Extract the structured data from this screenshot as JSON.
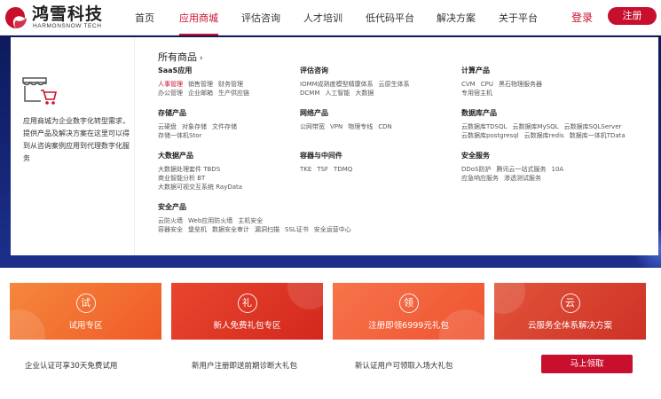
{
  "brand": {
    "name_cn": "鸿雪科技",
    "name_en": "HARMONSNOW TECH"
  },
  "nav": {
    "items": [
      {
        "label": "首页",
        "active": false
      },
      {
        "label": "应用商城",
        "active": true
      },
      {
        "label": "评估咨询",
        "active": false
      },
      {
        "label": "人才培训",
        "active": false
      },
      {
        "label": "低代码平台",
        "active": false
      },
      {
        "label": "解决方案",
        "active": false
      },
      {
        "label": "关于平台",
        "active": false
      }
    ],
    "login": "登录",
    "register": "注册"
  },
  "dropdown": {
    "description": "应用商城为企业数字化转型需求，提供产品及解决方案在这里可以得到从咨询案例应用到代理数字化服务",
    "all_products": "所有商品",
    "categories": [
      {
        "title": "SaaS应用",
        "lines": [
          [
            {
              "t": "人事管理",
              "hl": true
            },
            {
              "t": "销售管理"
            },
            {
              "t": "财务管理"
            }
          ],
          [
            {
              "t": "办公管理"
            },
            {
              "t": "企业邮箱"
            },
            {
              "t": "生产供应链"
            }
          ]
        ]
      },
      {
        "title": "评估咨询",
        "lines": [
          [
            {
              "t": "IOMM成熟度模型精康体系"
            },
            {
              "t": "云原生体系"
            }
          ],
          [
            {
              "t": "DCMM"
            },
            {
              "t": "人工智能"
            },
            {
              "t": "大数据"
            }
          ]
        ]
      },
      {
        "title": "计算产品",
        "lines": [
          [
            {
              "t": "CVM"
            },
            {
              "t": "CPU"
            },
            {
              "t": "黑石物理服务器"
            }
          ],
          [
            {
              "t": "专用宿主机"
            }
          ]
        ]
      },
      {
        "title": "存储产品",
        "lines": [
          [
            {
              "t": "云硬盘"
            },
            {
              "t": "对象存储"
            },
            {
              "t": "文件存储"
            }
          ],
          [
            {
              "t": "存储一体机Stor"
            }
          ]
        ]
      },
      {
        "title": "网络产品",
        "lines": [
          [
            {
              "t": "公网带宽"
            },
            {
              "t": "VPN"
            },
            {
              "t": "物理专线"
            },
            {
              "t": "CDN"
            }
          ]
        ]
      },
      {
        "title": "数据库产品",
        "lines": [
          [
            {
              "t": "云数据库TDSQL"
            },
            {
              "t": "云数据库MySQL"
            },
            {
              "t": "云数据库SQLServer"
            }
          ],
          [
            {
              "t": "云数据库postgresql"
            },
            {
              "t": "云数据库redis"
            },
            {
              "t": "数据库一体机TData"
            }
          ]
        ]
      },
      {
        "title": "大数据产品",
        "lines": [
          [
            {
              "t": "大数据处理套件 TBDS"
            }
          ],
          [
            {
              "t": "商业智能分析 BT"
            }
          ],
          [
            {
              "t": "大数据可视交互系统 RayData"
            }
          ]
        ]
      },
      {
        "title": "容器与中间件",
        "lines": [
          [
            {
              "t": "TKE"
            },
            {
              "t": "TSF"
            },
            {
              "t": "TDMQ"
            }
          ]
        ]
      },
      {
        "title": "安全服务",
        "lines": [
          [
            {
              "t": "DDoS防护"
            },
            {
              "t": "腾讯云一站式服务"
            },
            {
              "t": "10A"
            }
          ],
          [
            {
              "t": "应急响应服务"
            },
            {
              "t": "渗透测试服务"
            }
          ]
        ]
      },
      {
        "title": "安全产品",
        "lines": [
          [
            {
              "t": "云防火墙"
            },
            {
              "t": "Web应用防火墙"
            },
            {
              "t": "主机安全"
            }
          ],
          [
            {
              "t": "容器安全"
            },
            {
              "t": "堡垒机"
            },
            {
              "t": "数据安全审计"
            },
            {
              "t": "漏洞扫描"
            },
            {
              "t": "SSL证书"
            },
            {
              "t": "安全运营中心"
            }
          ]
        ]
      }
    ]
  },
  "cards": [
    {
      "icon_char": "试",
      "label": "试用专区"
    },
    {
      "icon_char": "礼",
      "label": "新人免费礼包专区"
    },
    {
      "icon_char": "领",
      "label": "注册即领6999元礼包"
    },
    {
      "icon_char": "云",
      "label": "云服务全体系解决方案"
    }
  ],
  "promos": [
    "企业认证可享30天免费试用",
    "新用户注册即送前期诊断大礼包",
    "新认证用户可领取入场大礼包"
  ],
  "claim_button": "马上领取",
  "colors": {
    "accent": "#c8102e",
    "band": "#1c2f8c"
  }
}
